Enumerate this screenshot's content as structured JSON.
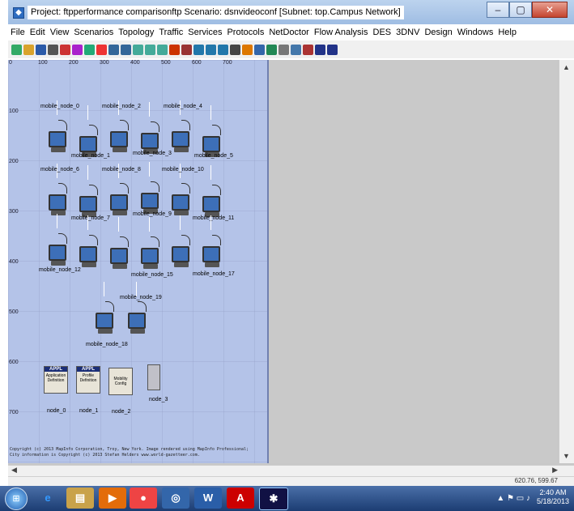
{
  "window": {
    "title": "Project: ftpperformance comparisonftp Scenario: dsnvideoconf  [Subnet: top.Campus Network]",
    "icon": "opnet-app-icon"
  },
  "menu": [
    "File",
    "Edit",
    "View",
    "Scenarios",
    "Topology",
    "Traffic",
    "Services",
    "Protocols",
    "NetDoctor",
    "Flow Analysis",
    "DES",
    "3DNV",
    "Design",
    "Windows",
    "Help"
  ],
  "ruler": {
    "top": [
      "0",
      "100",
      "200",
      "300",
      "400",
      "500",
      "600",
      "700"
    ],
    "left": [
      "100",
      "200",
      "300",
      "400",
      "500",
      "600",
      "700"
    ]
  },
  "nodes": [
    {
      "label": "mobile_node_0"
    },
    {
      "label": "mobile_node_1"
    },
    {
      "label": "mobile_node_2"
    },
    {
      "label": "mobile_node_3"
    },
    {
      "label": "mobile_node_4"
    },
    {
      "label": "mobile_node_5"
    },
    {
      "label": "mobile_node_6"
    },
    {
      "label": "mobile_node_7"
    },
    {
      "label": "mobile_node_8"
    },
    {
      "label": "mobile_node_9"
    },
    {
      "label": "mobile_node_10"
    },
    {
      "label": "mobile_node_11"
    },
    {
      "label": "mobile_node_12"
    },
    {
      "label": "mobile_node_15"
    },
    {
      "label": "mobile_node_17"
    },
    {
      "label": "mobile_node_18"
    },
    {
      "label": "mobile_node_19"
    }
  ],
  "special_nodes": [
    {
      "label": "node_0",
      "badge": "APPL",
      "caption": "Application Definition"
    },
    {
      "label": "node_1",
      "badge": "APPL",
      "caption": "Profile Definition"
    },
    {
      "label": "node_2",
      "badge": "",
      "caption": "Mobility Config"
    },
    {
      "label": "node_3",
      "badge": "",
      "caption": ""
    }
  ],
  "copyright": [
    "Copyright (c) 2013 MapInfo Corporation, Troy, New York. Image rendered using MapInfo Professional;",
    "City information is Copyright (c) 2013 Stefan Helders www.world-gazetteer.com."
  ],
  "status": {
    "coords": "620.76, 599.67"
  },
  "taskbar": {
    "time": "2:40 AM",
    "date": "5/18/2013"
  }
}
